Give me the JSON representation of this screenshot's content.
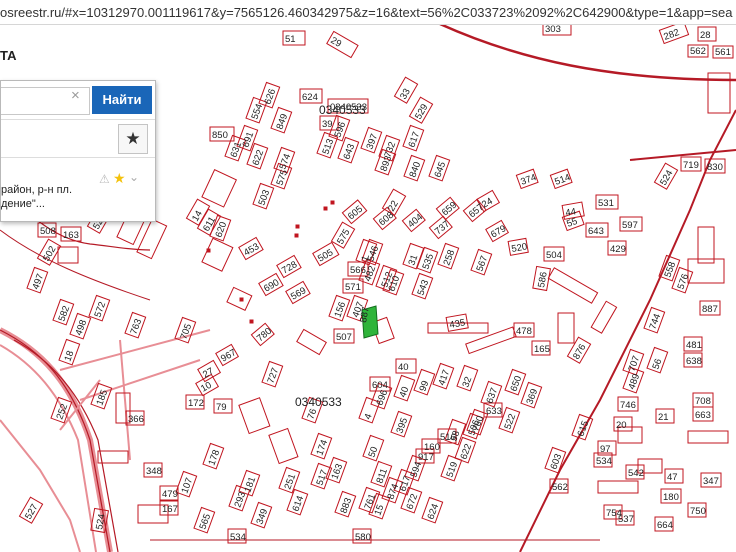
{
  "url": "osreestr.ru/#x=10312970.001119617&y=7565126.460342975&z=16&text=56%2C033723%2092%2C642900&type=1&app=sea",
  "corner_label": "ТА",
  "search": {
    "value": "",
    "button": "Найти"
  },
  "result": {
    "line1": "район, р-н пл.",
    "line2": "дение\"..."
  },
  "quarters": [
    "0340533",
    "0340533"
  ],
  "colors": {
    "parcel": "#c0151f",
    "road": "#e88e95",
    "selected": "#2fb43a",
    "button": "#1a66b8"
  },
  "parcel_labels": [
    "29",
    "51",
    "303",
    "282",
    "28",
    "562",
    "561",
    "626",
    "624",
    "554",
    "849",
    "0340533",
    "33",
    "529",
    "39",
    "596",
    "850",
    "691",
    "631",
    "622",
    "617",
    "513",
    "643",
    "397",
    "732",
    "645",
    "574",
    "575",
    "503",
    "893",
    "840",
    "374",
    "514",
    "531",
    "719",
    "830",
    "524",
    "659",
    "657",
    "679",
    "520",
    "504",
    "24",
    "44",
    "643",
    "597",
    "508",
    "163",
    "522",
    "14",
    "611",
    "620",
    "453",
    "605",
    "608",
    "22",
    "404",
    "737",
    "55",
    "502",
    "497",
    "258",
    "567",
    "586",
    "429",
    "575",
    "505",
    "566",
    "31",
    "535",
    "1",
    "728",
    "690",
    "569",
    "571",
    "546",
    "482",
    "512",
    "610",
    "543",
    "558",
    "576",
    "582",
    "498",
    "572",
    "156",
    "407",
    "507",
    "435",
    "478",
    "744",
    "887",
    "763",
    "705",
    "780",
    "40",
    "165",
    "876",
    "481",
    "638",
    "707",
    "18",
    "967",
    "27",
    "10",
    "172",
    "79",
    "727",
    "604",
    "696",
    "40",
    "99",
    "417",
    "32",
    "637",
    "650",
    "746",
    "708",
    "663",
    "489",
    "56",
    "185",
    "366",
    "252",
    "4",
    "76",
    "395",
    "58",
    "506",
    "633",
    "760",
    "522",
    "369",
    "20",
    "21",
    "97",
    "615",
    "534",
    "542",
    "47",
    "347",
    "180",
    "348",
    "178",
    "50",
    "160",
    "174",
    "163",
    "517",
    "917",
    "516",
    "622",
    "519",
    "603",
    "562",
    "754",
    "479",
    "107",
    "167",
    "181",
    "293",
    "349",
    "251",
    "614",
    "761",
    "883",
    "15",
    "874",
    "811",
    "672",
    "617",
    "624",
    "750",
    "580",
    "524",
    "565",
    "534",
    "527",
    "594",
    "537",
    "664",
    "819",
    "313",
    "18",
    "467",
    "884",
    "504",
    "916",
    "506",
    "85",
    "343",
    "163"
  ]
}
